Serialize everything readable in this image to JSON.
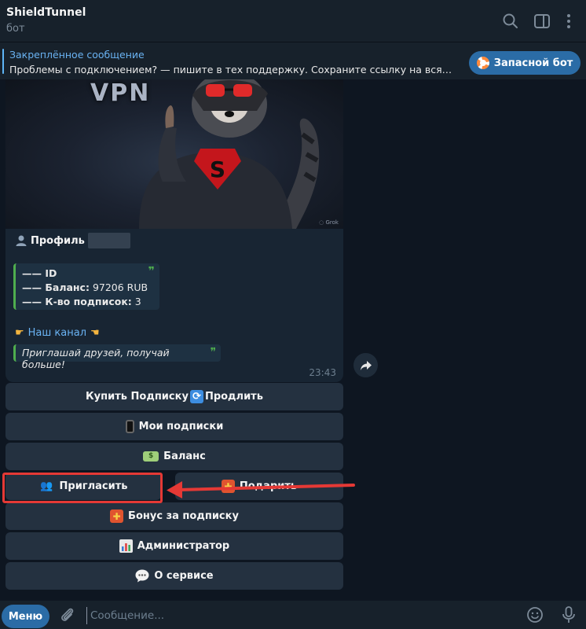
{
  "header": {
    "title": "ShieldTunnel",
    "subtitle": "бот",
    "icons": [
      "search-icon",
      "sidebar-toggle-icon",
      "more-vertical-icon"
    ]
  },
  "pinned": {
    "title": "Закреплённое сообщение",
    "text": "Проблемы с подключением? — пишите в тех поддержку. Сохраните ссылку на всякий случай",
    "button_label": "Запасной бот"
  },
  "message": {
    "image_text": "VPN",
    "profile_label": "Профиль",
    "quote1": {
      "id_label": "—— ID",
      "balance_label": "—— Баланс:",
      "balance_value": "97206 RUB",
      "subs_label": "—— К-во подписок:",
      "subs_value": "3"
    },
    "channel_label": "Наш канал",
    "quote2": "Приглашай друзей, получай больше!",
    "time": "23:43"
  },
  "keyboard": {
    "buy_label": "Купить Подписку",
    "renew_label": "Продлить",
    "my_subs_label": "Мои подписки",
    "balance_label": "Баланс",
    "invite_label": "Пригласить",
    "gift_label": "Подарить",
    "bonus_label": "Бонус за подписку",
    "admin_label": "Администратор",
    "about_label": "О сервисе"
  },
  "composer": {
    "menu_label": "Меню",
    "placeholder": "Сообщение..."
  },
  "colors": {
    "background": "#0e1621",
    "panel": "#17212b",
    "bubble": "#182533",
    "button": "#243140",
    "accent": "#2b6ca6",
    "link": "#6ab3f3",
    "quote_border": "#4fae4e",
    "highlight": "#e53935"
  }
}
